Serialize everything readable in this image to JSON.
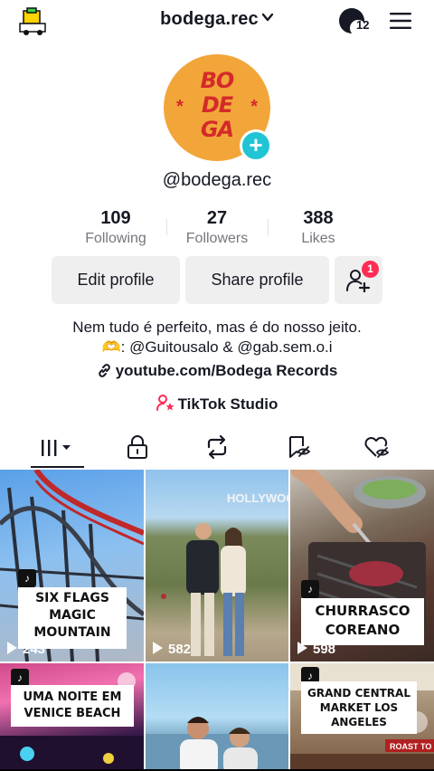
{
  "header": {
    "username": "bodega.rec",
    "notification_count": "12"
  },
  "profile": {
    "avatar_text": "BODEGA",
    "handle": "@bodega.rec",
    "stats": [
      {
        "value": "109",
        "label": "Following"
      },
      {
        "value": "27",
        "label": "Followers"
      },
      {
        "value": "388",
        "label": "Likes"
      }
    ],
    "edit_button": "Edit profile",
    "share_button": "Share profile",
    "friend_badge": "1",
    "bio_line1": "Nem tudo é perfeito, mas é do nosso jeito.",
    "bio_line2_prefix": "🫶: ",
    "bio_line2": "@Guitousalo & @gab.sem.o.i",
    "link": "youtube.com/Bodega Records",
    "studio": "TikTok Studio"
  },
  "tabs": [
    {
      "icon": "videos-grid-icon",
      "active": true
    },
    {
      "icon": "lock-icon",
      "active": false
    },
    {
      "icon": "repost-icon",
      "active": false
    },
    {
      "icon": "saved-icon",
      "active": false
    },
    {
      "icon": "liked-icon",
      "active": false
    }
  ],
  "videos": [
    {
      "caption": "SIX FLAGS MAGIC MOUNTAIN",
      "views": "243"
    },
    {
      "caption": "",
      "views": "582"
    },
    {
      "caption": "CHURRASCO COREANO",
      "views": "598"
    },
    {
      "caption": "UMA NOITE EM VENICE BEACH",
      "views": ""
    },
    {
      "caption": "",
      "views": ""
    },
    {
      "caption": "GRAND CENTRAL MARKET LOS ANGELES",
      "views": ""
    }
  ],
  "colors": {
    "accent_cyan": "#20c4d4",
    "badge_red": "#fe2c55",
    "avatar_orange": "#f2a63a",
    "logo_red": "#d42a2a"
  }
}
